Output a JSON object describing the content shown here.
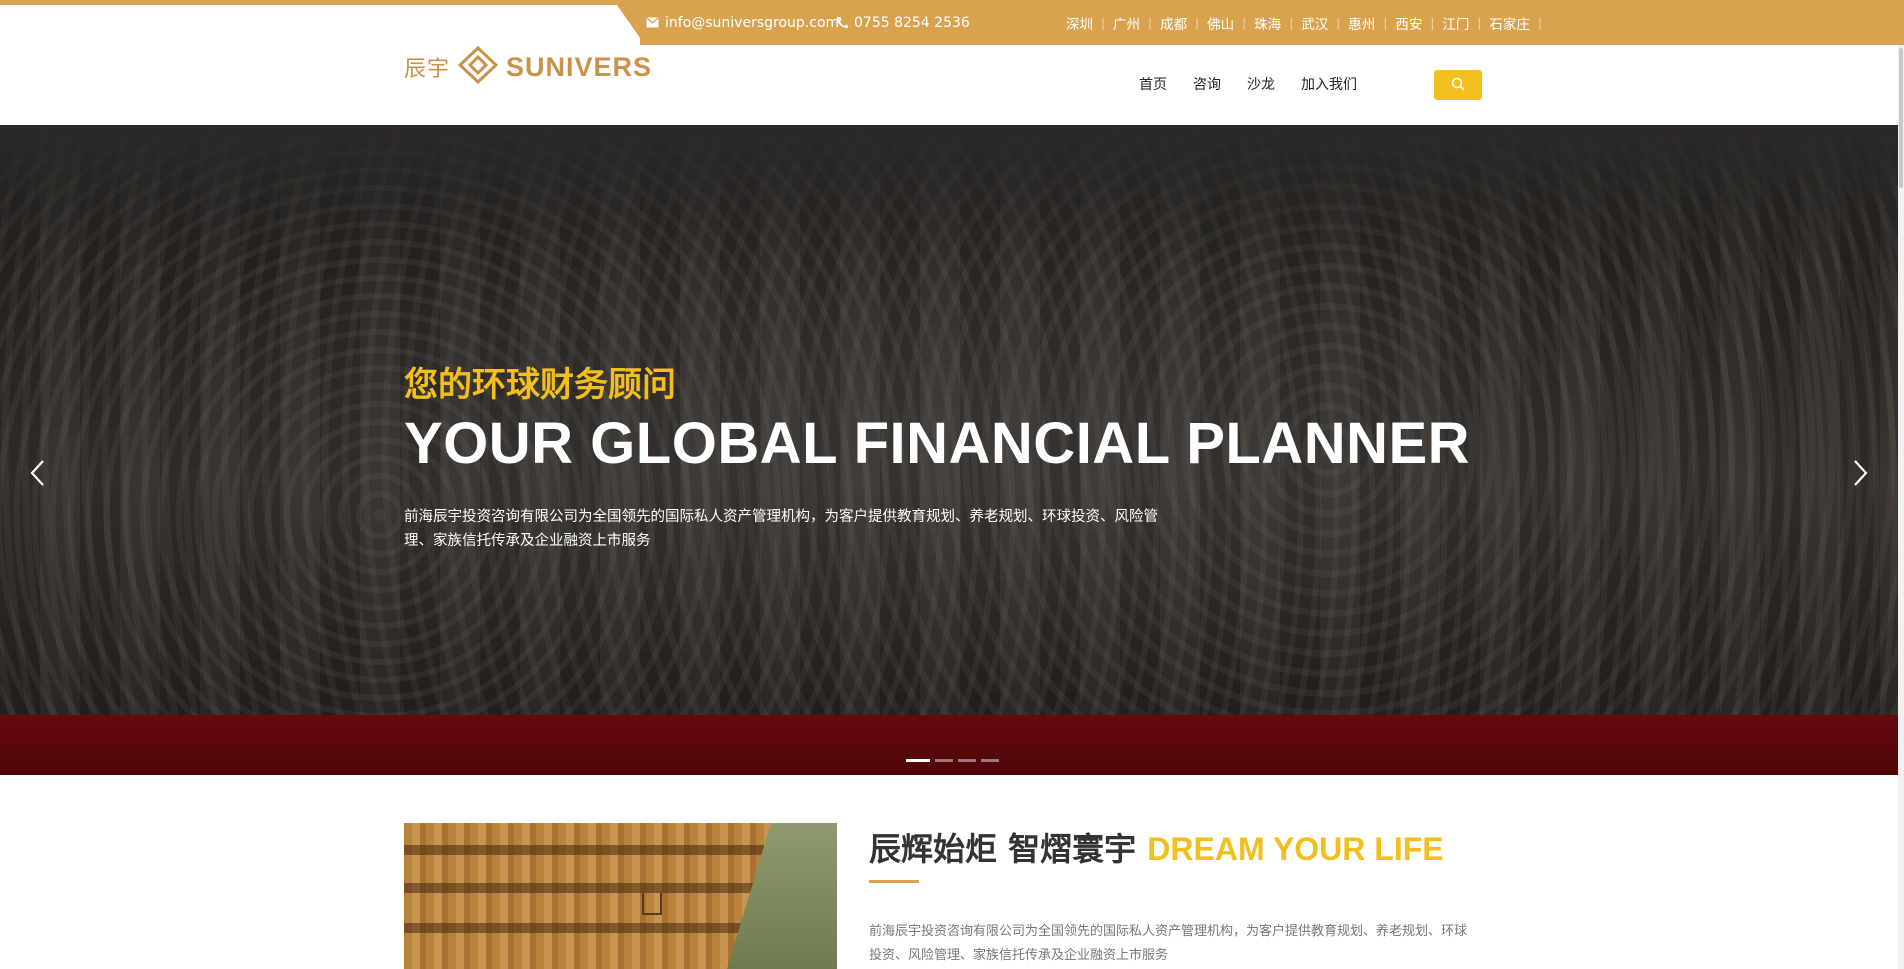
{
  "topbar": {
    "email": "info@suniversgroup.com",
    "phone": "0755 8254 2536",
    "cities": [
      "深圳",
      "广州",
      "成都",
      "佛山",
      "珠海",
      "武汉",
      "惠州",
      "西安",
      "江门",
      "石家庄"
    ]
  },
  "logo": {
    "cn": "辰宇",
    "en": "SUNIVERS"
  },
  "nav": {
    "items": [
      "首页",
      "咨询",
      "沙龙",
      "加入我们"
    ]
  },
  "hero": {
    "title_cn": "您的环球财务顾问",
    "title_en": "YOUR GLOBAL FINANCIAL PLANNER",
    "description": "前海辰宇投资咨询有限公司为全国领先的国际私人资产管理机构，为客户提供教育规划、养老规划、环球投资、风险管理、家族信托传承及企业融资上市服务",
    "slides_total": 4,
    "active_slide": 1
  },
  "about": {
    "title_cn": "辰辉始炬 智熠寰宇",
    "title_en": "DREAM YOUR LIFE",
    "description": "前海辰宇投资咨询有限公司为全国领先的国际私人资产管理机构，为客户提供教育规划、养老规划、环球投资、风险管理、家族信托传承及企业融资上市服务"
  },
  "colors": {
    "gold": "#d9a24f",
    "yellow": "#f2bf1c"
  },
  "icons": [
    "mail-icon",
    "phone-icon",
    "logo-mark-icon",
    "search-icon",
    "chevron-left-icon",
    "chevron-right-icon"
  ]
}
